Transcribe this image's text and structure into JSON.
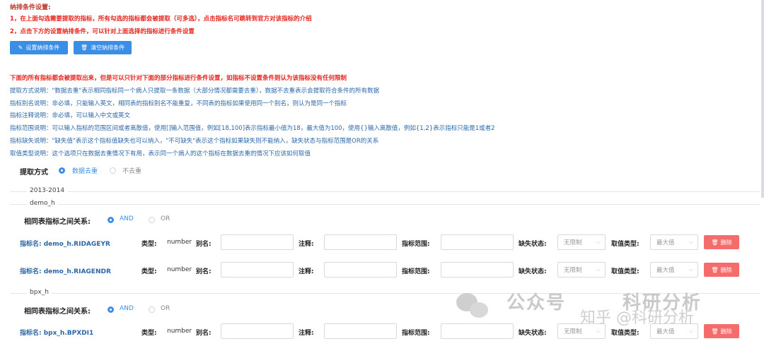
{
  "header": {
    "title": "纳排条件设置:"
  },
  "instructions": [
    "1，在上面勾选需要提取的指标，所有勾选的指标都会被提取（可多选），点击指标名可跳转到官方对该指标的介绍",
    "2，点击下方的设置纳排条件，可以针对上面选择的指标进行条件设置"
  ],
  "buttons": {
    "set": "设置纳排条件",
    "clear": "清空纳排条件"
  },
  "notes": {
    "warning": "下面的所有指标都会被提取出来，但是可以只针对下面的部分指标进行条件设置，如指标不设置条件则认为该指标没有任何限制",
    "lines": [
      "提取方式说明：\"数据去重\"表示相同指标同一个病人只提取一条数据（大部分情况都需要去重），数据不去重表示会提取符合条件的所有数据",
      "指标别名说明：非必填，只能输入英文，相同表的指标别名不能重复，不同表的指标如果使用同一个别名，则认为是同一个指标",
      "指标注释说明：非必填，可以输入中文或英文",
      "指标范围说明：可以输入指标的范围区间或者离散值，使用[]输入范围值，例如[18,100]表示指标最小值为18，最大值为100，使用{}输入离散值，例如{1,2}表示指标只能是1或者2",
      "指标缺失说明：\"缺失值\"表示这个指标值缺失也可以纳入，\"不可缺失\"表示这个指标如果缺失则不能纳入，缺失状态与指标范围是OR的关系",
      "取值类型说明：这个选项只在数据去重情况下有用，表示同一个病人的这个指标在数据去重的情况下应该如何取值"
    ]
  },
  "extraction": {
    "label": "提取方式",
    "opt_dedup": "数据去重",
    "opt_nodedup": "不去重"
  },
  "year_group": "2013-2014",
  "labels": {
    "relation": "相同表指标之间关系:",
    "and": "AND",
    "or": "OR",
    "type": "类型:",
    "alias": "别名:",
    "note": "注释:",
    "range": "指标范围:",
    "missing": "缺失状态:",
    "valuetype": "取值类型:",
    "delete": "删除",
    "missing_default": "无限制",
    "valuetype_default": "最大值"
  },
  "tables": [
    {
      "name": "demo_h",
      "fields": [
        {
          "label": "指标名: demo_h.RIDAGEYR",
          "type": "number"
        },
        {
          "label": "指标名: demo_h.RIAGENDR",
          "type": "number"
        }
      ]
    },
    {
      "name": "bpx_h",
      "fields": [
        {
          "label": "指标名: bpx_h.BPXDI1",
          "type": "number"
        }
      ]
    }
  ],
  "watermark": {
    "wechat": "公众号",
    "brand": "科研分析",
    "zhihu": "知乎 @科研分析"
  },
  "colors": {
    "accent": "#3a8ee6",
    "danger": "#f56c6c",
    "warn_text": "#e6231c",
    "note_text": "#2b67a8"
  }
}
